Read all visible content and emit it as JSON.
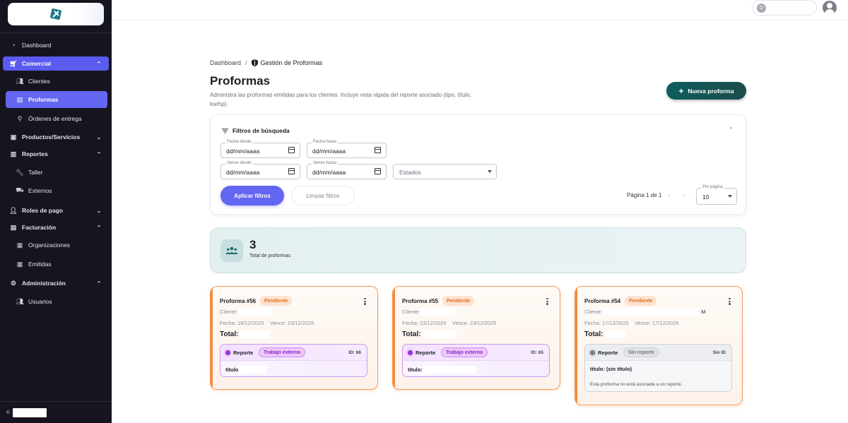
{
  "sidebar": {
    "items": [
      {
        "label": "Dashboard",
        "icon": "dashboard-icon"
      },
      {
        "label": "Comercial",
        "icon": "cart-icon"
      },
      {
        "label": "Clientes",
        "icon": "users-icon"
      },
      {
        "label": "Proformas",
        "icon": "document-icon"
      },
      {
        "label": "Órdenes de entrega",
        "icon": "delivery-icon"
      },
      {
        "label": "Productos/Servicios",
        "icon": "box-icon"
      },
      {
        "label": "Reportes",
        "icon": "report-icon"
      },
      {
        "label": "Taller",
        "icon": "wrench-icon"
      },
      {
        "label": "Externos",
        "icon": "truck-icon"
      },
      {
        "label": "Roles de pago",
        "icon": "user-icon"
      },
      {
        "label": "Facturación",
        "icon": "invoice-icon"
      },
      {
        "label": "Organizaciones",
        "icon": "building-icon"
      },
      {
        "label": "Emitidas",
        "icon": "building-icon"
      },
      {
        "label": "Administración",
        "icon": "gear-icon"
      },
      {
        "label": "Usuarios",
        "icon": "users-icon"
      }
    ],
    "copyright": "©"
  },
  "topbar": {
    "user_initial": "O"
  },
  "breadcrumb": {
    "home": "Dashboard",
    "separator": "/",
    "current": "Gestión de Proformas"
  },
  "page": {
    "title": "Proformas",
    "subtitle": "Administra las proformas emitidas para los clientes. Incluye vista rápida del reporte asociado (tipo, título, kw/hp).",
    "new_button": "Nueva proforma"
  },
  "filters": {
    "title": "Filtros de búsqueda",
    "fecha_desde": {
      "label": "Fecha desde",
      "value": "dd/mm/aaaa"
    },
    "fecha_hasta": {
      "label": "Fecha hasta",
      "value": "dd/mm/aaaa"
    },
    "vence_desde": {
      "label": "Vence desde",
      "value": "dd/mm/aaaa"
    },
    "vence_hasta": {
      "label": "Vence hasta",
      "value": "dd/mm/aaaa"
    },
    "estados": {
      "value": "Estados"
    },
    "apply": "Aplicar filtros",
    "clear": "Limpiar filtros",
    "pager": "Página 1 de 1",
    "per_page": {
      "label": "Por página",
      "value": "10"
    }
  },
  "summary": {
    "total": "3",
    "label": "Total de proformas"
  },
  "proformas": [
    {
      "title": "Proforma #56",
      "status": "Pendiente",
      "cliente": "Cliente:",
      "dates": "Fecha: 18/12/2025    Vence: 23/12/2025",
      "total": "Total:",
      "report": {
        "label": "Reporte",
        "type": "Trabajo externo",
        "id": "ID: 66",
        "titulo": "título"
      }
    },
    {
      "title": "Proforma #55",
      "status": "Pendiente",
      "cliente": "Cliente:",
      "dates": "Fecha: 23/12/2025    Vence: 23/12/2025",
      "total": "Total:",
      "report": {
        "label": "Reporte",
        "type": "Trabajo externo",
        "id": "ID: 65",
        "titulo": "título:"
      }
    },
    {
      "title": "Proforma #54",
      "status": "Pendiente",
      "cliente": "Cliente:",
      "cliente_suffix": ".M",
      "dates": "Fecha: 17/12/2025    Vence: 17/12/2025",
      "total": "Total:",
      "report": {
        "label": "Reporte",
        "type": "Sin reporte",
        "id": "Sin ID",
        "titulo": "título: (sin título)",
        "note": "Esta proforma no está asociada a un reporte."
      }
    }
  ],
  "colors": {
    "accent": "#6366f1",
    "sidebar_bg": "#16151f",
    "primary_dark": "#0f5d5e",
    "pending": "#e07020",
    "report_purple": "#9b30d8"
  }
}
